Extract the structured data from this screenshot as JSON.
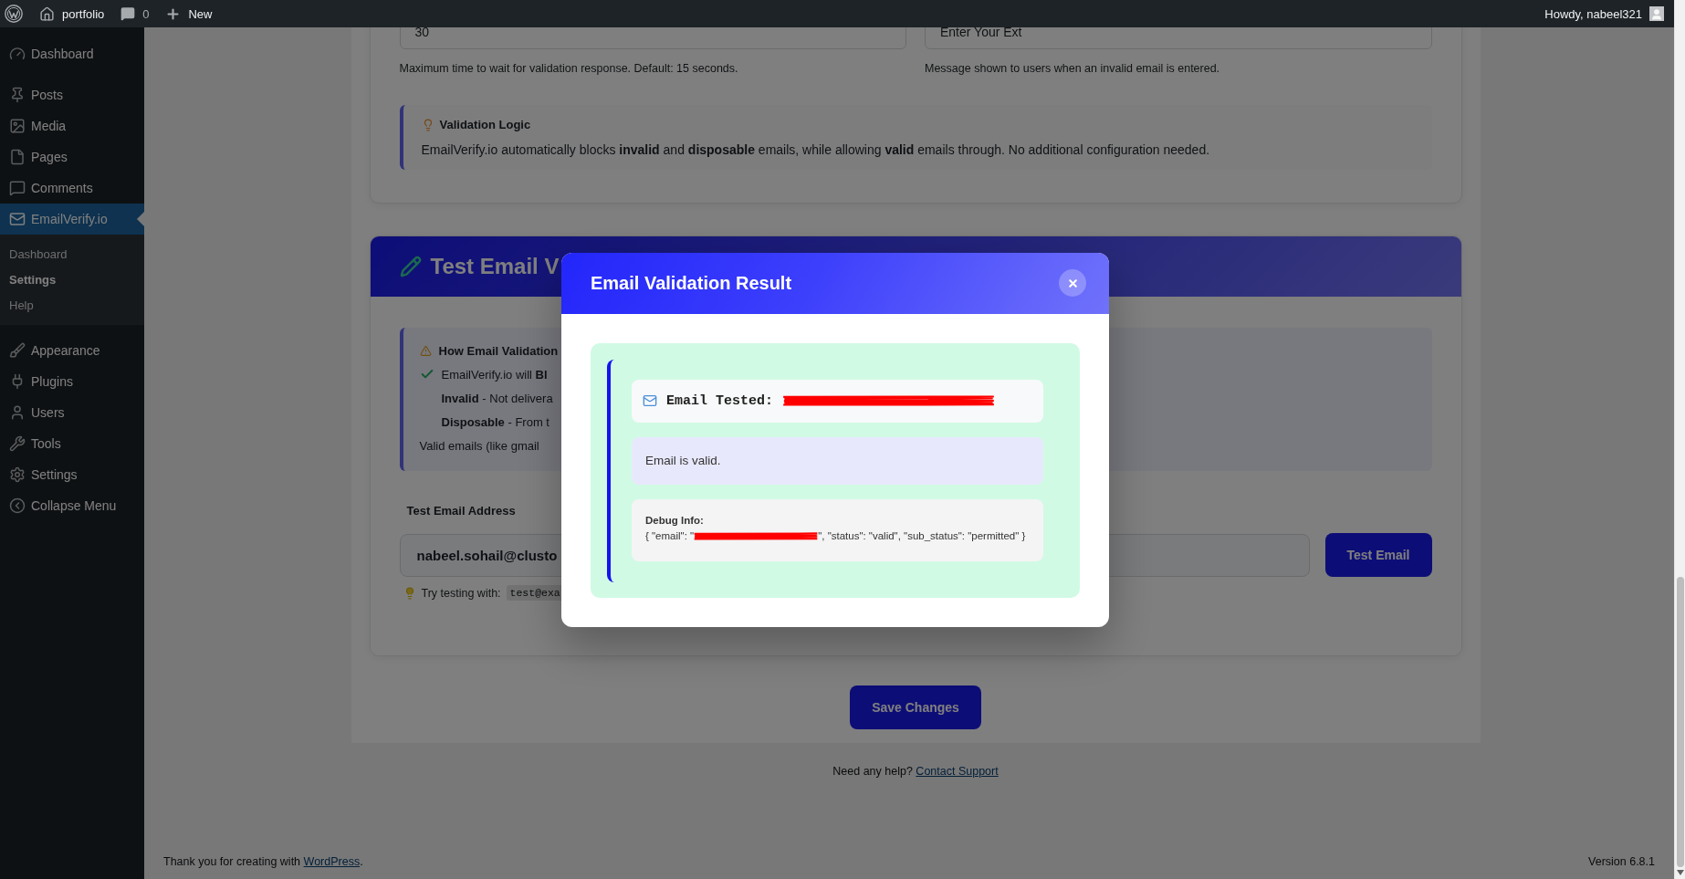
{
  "admin_bar": {
    "site_name": "portfolio",
    "comments_count": "0",
    "new_label": "New",
    "greeting": "Howdy, nabeel321"
  },
  "sidebar": {
    "groups": [
      {
        "items": [
          {
            "label": "Dashboard",
            "selected": false
          }
        ]
      },
      {
        "items": [
          {
            "label": "Posts",
            "selected": false
          },
          {
            "label": "Media",
            "selected": false
          },
          {
            "label": "Pages",
            "selected": false
          },
          {
            "label": "Comments",
            "selected": false
          },
          {
            "label": "EmailVerify.io",
            "selected": true,
            "children": [
              {
                "label": "Dashboard",
                "selected": false
              },
              {
                "label": "Settings",
                "selected": true
              },
              {
                "label": "Help",
                "selected": false
              }
            ]
          }
        ]
      },
      {
        "items": [
          {
            "label": "Appearance",
            "selected": false
          },
          {
            "label": "Plugins",
            "selected": false
          },
          {
            "label": "Users",
            "selected": false
          },
          {
            "label": "Tools",
            "selected": false
          },
          {
            "label": "Settings",
            "selected": false
          },
          {
            "label": "Collapse Menu",
            "selected": false
          }
        ]
      }
    ]
  },
  "settings_card": {
    "fields": [
      {
        "value": "30",
        "help": "Maximum time to wait for validation response. Default: 15 seconds."
      },
      {
        "value": "Enter Your Ext",
        "help": "Message shown to users when an invalid email is entered."
      }
    ],
    "notice": {
      "title": "Validation Logic",
      "text": "EmailVerify.io automatically blocks **invalid** and **disposable** emails, while allowing **valid** emails through. No additional configuration needed."
    }
  },
  "test_card": {
    "title": "Test Email V",
    "info": {
      "heading": "How Email Validation",
      "lines": [
        {
          "kind": "check",
          "text": "EmailVerify.io will **Bl**"
        },
        {
          "kind": "indented",
          "text": "**Invalid** - Not delivera"
        },
        {
          "kind": "indented",
          "text": "**Disposable** - From t"
        },
        {
          "kind": "plain",
          "text": "Valid emails (like gmail"
        }
      ]
    },
    "email_label": "Test Email Address",
    "email_value": "nabeel.sohail@clusto",
    "button": "Test Email",
    "hint": {
      "text": "Try testing with:",
      "examples": [
        "test@exa"
      ]
    }
  },
  "save_button": "Save Changes",
  "help": {
    "text": "Need any help?",
    "link": "Contact Support"
  },
  "footer": {
    "credit": "Thank you for creating with",
    "credit_link": "WordPress",
    "credit_end": ".",
    "version": "Version 6.8.1"
  },
  "dialog": {
    "title": "Email Validation Result",
    "tested_label": "Email Tested:",
    "tested_redacted": true,
    "message": "Email is valid.",
    "debug_title": "Debug Info:",
    "debug_before": "{ \"email\": \"",
    "debug_redacted": true,
    "debug_after": "\", \"status\": \"valid\", \"sub_status\": \"permitted\" }"
  }
}
